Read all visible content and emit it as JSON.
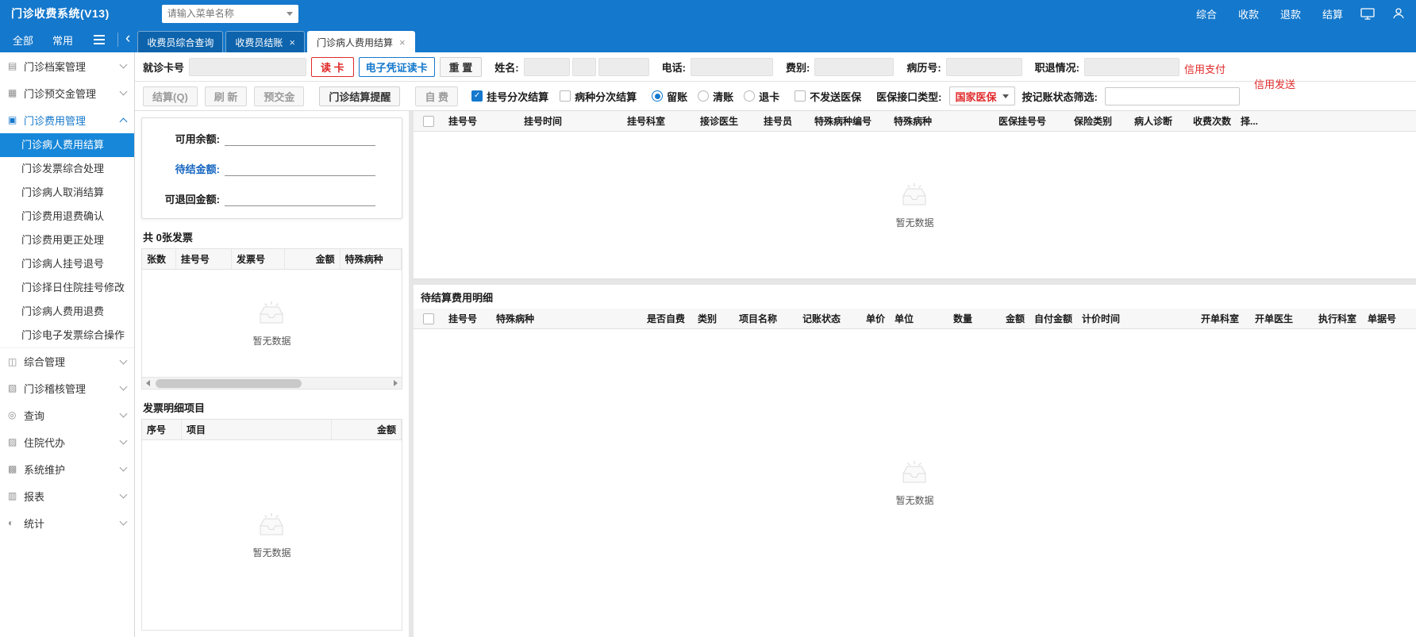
{
  "topbar": {
    "title": "门诊收费系统(V13)",
    "search_placeholder": "请输入菜单名称",
    "links": [
      "综合",
      "收款",
      "退款",
      "结算"
    ]
  },
  "tabbar": {
    "filters": [
      "全部",
      "常用"
    ],
    "tabs": [
      {
        "label": "收费员综合查询",
        "active": false,
        "closable": false
      },
      {
        "label": "收费员结账",
        "active": false,
        "closable": true
      },
      {
        "label": "门诊病人费用结算",
        "active": true,
        "closable": true
      }
    ]
  },
  "sidebar": {
    "items": [
      {
        "label": "门诊档案管理",
        "type": "group",
        "expanded": false,
        "icon": "▤"
      },
      {
        "label": "门诊预交金管理",
        "type": "group",
        "expanded": false,
        "icon": "▦"
      },
      {
        "label": "门诊费用管理",
        "type": "group",
        "expanded": true,
        "icon": "▣"
      },
      {
        "label": "门诊病人费用结算",
        "type": "child",
        "active": true
      },
      {
        "label": "门诊发票综合处理",
        "type": "child",
        "active": false
      },
      {
        "label": "门诊病人取消结算",
        "type": "child",
        "active": false
      },
      {
        "label": "门诊费用退费确认",
        "type": "child",
        "active": false
      },
      {
        "label": "门诊费用更正处理",
        "type": "child",
        "active": false
      },
      {
        "label": "门诊病人挂号退号",
        "type": "child",
        "active": false
      },
      {
        "label": "门诊择日住院挂号修改",
        "type": "child",
        "active": false
      },
      {
        "label": "门诊病人费用退费",
        "type": "child",
        "active": false
      },
      {
        "label": "门诊电子发票综合操作",
        "type": "child",
        "active": false
      },
      {
        "label": "综合管理",
        "type": "group",
        "expanded": false,
        "icon": "◫"
      },
      {
        "label": "门诊稽核管理",
        "type": "group",
        "expanded": false,
        "icon": "▧"
      },
      {
        "label": "查询",
        "type": "group",
        "expanded": false,
        "icon": "◎"
      },
      {
        "label": "住院代办",
        "type": "group",
        "expanded": false,
        "icon": "▨"
      },
      {
        "label": "系统维护",
        "type": "group",
        "expanded": false,
        "icon": "▩"
      },
      {
        "label": "报表",
        "type": "group",
        "expanded": false,
        "icon": "▥"
      },
      {
        "label": "统计",
        "type": "group",
        "expanded": false,
        "icon": "◐"
      }
    ]
  },
  "patient_form": {
    "card_label": "就诊卡号",
    "card_value": "",
    "read_card_label": "读 卡",
    "e_cert_label": "电子凭证读卡",
    "reset_label": "重 置",
    "name_label": "姓名:",
    "name_values": [
      "",
      "",
      ""
    ],
    "phone_label": "电话:",
    "phone_value": "",
    "fee_type_label": "费别:",
    "fee_type_value": "",
    "record_label": "病历号:",
    "record_value": "",
    "retire_label": "职退情况:",
    "retire_value": "",
    "credit_pay": "信用支付",
    "credit_send": "信用发送"
  },
  "action_bar": {
    "settle_label": "结算(Q)",
    "refresh_label": "刷 新",
    "prepay_label": "预交金",
    "remind_label": "门诊结算提醒",
    "selfpay_label": "自 费",
    "checkboxes": [
      {
        "label": "挂号分次结算",
        "checked": true
      },
      {
        "label": "病种分次结算",
        "checked": false
      }
    ],
    "radios": [
      {
        "label": "留账",
        "checked": true
      },
      {
        "label": "清账",
        "checked": false
      },
      {
        "label": "退卡",
        "checked": false
      }
    ],
    "no_send": {
      "label": "不发送医保",
      "checked": false
    },
    "insurance_label": "医保接口类型:",
    "insurance_value": "国家医保",
    "filter_label": "按记账状态筛选:",
    "filter_value": ""
  },
  "balance_panel": {
    "rows": [
      {
        "label": "可用余额:",
        "value": "",
        "emph": false
      },
      {
        "label": "待结金额:",
        "value": "",
        "emph": true
      },
      {
        "label": "可退回金额:",
        "value": "",
        "emph": false
      }
    ]
  },
  "invoice_summary": {
    "title": "共 0张发票",
    "columns": [
      "张数",
      "挂号号",
      "发票号",
      "金额",
      "特殊病种"
    ],
    "rows": [],
    "empty_text": "暂无数据"
  },
  "invoice_detail": {
    "title": "发票明细项目",
    "columns": [
      "序号",
      "项目",
      "金额"
    ],
    "rows": [],
    "empty_text": "暂无数据"
  },
  "registration_table": {
    "columns": [
      "挂号号",
      "挂号时间",
      "挂号科室",
      "接诊医生",
      "挂号员",
      "特殊病种编号",
      "特殊病种",
      "医保挂号号",
      "保险类别",
      "病人诊断",
      "收费次数",
      "择..."
    ],
    "rows": [],
    "empty_text": "暂无数据"
  },
  "pending_fee_table": {
    "title": "待结算费用明细",
    "columns": [
      "挂号号",
      "特殊病种",
      "是否自费",
      "类别",
      "项目名称",
      "记账状态",
      "单价",
      "单位",
      "数量",
      "金额",
      "自付金额",
      "计价时间",
      "开单科室",
      "开单医生",
      "执行科室",
      "单据号"
    ],
    "rows": [],
    "empty_text": "暂无数据"
  }
}
